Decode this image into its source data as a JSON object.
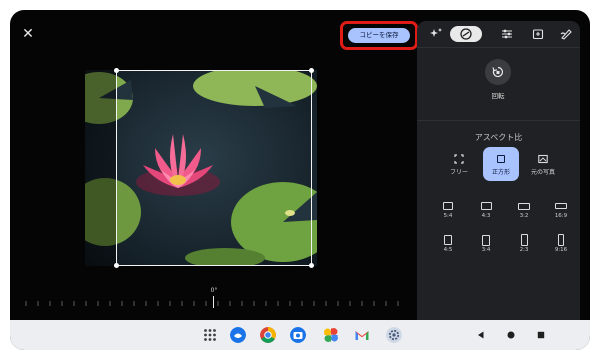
{
  "toolbar": {
    "close_icon": "close-icon",
    "save_copy_label": "コピーを保存"
  },
  "canvas": {
    "rotation_angle": "0°"
  },
  "panel": {
    "tabs": [
      {
        "icon": "auto-enhance-icon"
      },
      {
        "icon": "crop-rotate-icon",
        "active": true
      },
      {
        "icon": "adjust-icon"
      },
      {
        "icon": "filter-icon"
      },
      {
        "icon": "markup-icon"
      }
    ],
    "rotate_label": "回転",
    "aspect_title": "アスペクト比",
    "aspect_primary": [
      {
        "label": "フリー",
        "icon": "free-crop-icon",
        "selected": false
      },
      {
        "label": "正方形",
        "icon": "square-icon",
        "selected": true
      },
      {
        "label": "元の写真",
        "icon": "original-photo-icon",
        "selected": false
      }
    ],
    "aspect_ratios_row1": [
      "5:4",
      "4:3",
      "3:2",
      "16:9"
    ],
    "aspect_ratios_row2": [
      "4:5",
      "3:4",
      "2:3",
      "9:16"
    ]
  },
  "navbar": {
    "apps": [
      "app-drawer-icon",
      "app-icon",
      "chrome-icon",
      "camera-icon",
      "photos-icon",
      "gmail-icon",
      "settings-icon"
    ],
    "buttons": [
      "back-icon",
      "home-icon",
      "recents-icon"
    ]
  },
  "colors": {
    "accent": "#a9c3ff",
    "highlight_border": "#e11c17",
    "panel_bg": "#202124"
  }
}
